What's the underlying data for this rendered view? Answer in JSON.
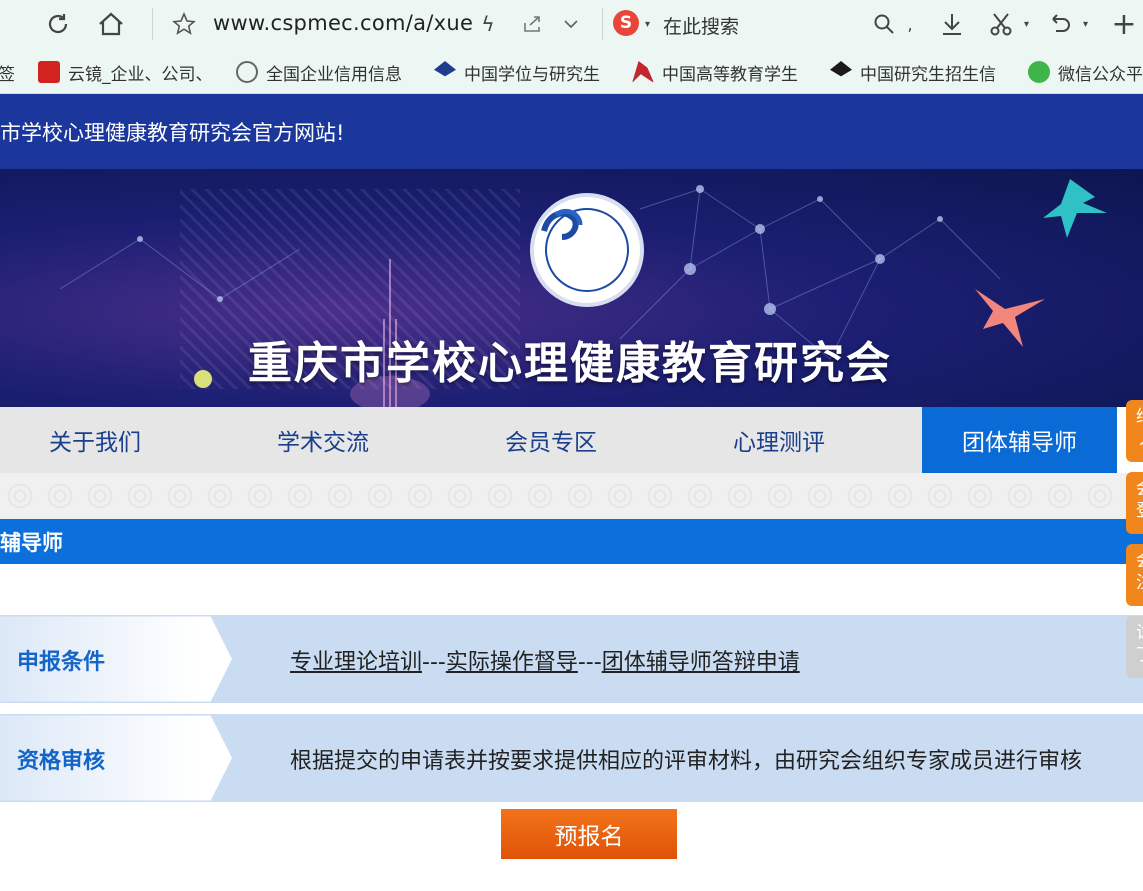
{
  "browser": {
    "url": "www.cspmec.com/a/xue",
    "search_placeholder": "在此搜索",
    "search_engine_icon": "S",
    "bookmark_partial": "签",
    "bookmarks": [
      {
        "label": "云镜_企业、公司、",
        "icon": "tianyancha-icon",
        "color": "#d3231e"
      },
      {
        "label": "全国企业信用信息",
        "icon": "globe-icon",
        "color": "#666666"
      },
      {
        "label": "中国学位与研究生",
        "icon": "graduation-cap-icon",
        "color": "#1f3d8a"
      },
      {
        "label": "中国高等教育学生",
        "icon": "bird-logo-icon",
        "color": "#c0282d"
      },
      {
        "label": "中国研究生招生信",
        "icon": "graduation-cap-icon",
        "color": "#1a1a1a"
      },
      {
        "label": "微信公众平",
        "icon": "wechat-icon",
        "color": "#3fb449"
      }
    ]
  },
  "site": {
    "welcome": "市学校心理健康教育研究会官方网站!",
    "banner_title": "重庆市学校心理健康教育研究会",
    "nav": [
      {
        "label": "关于我们",
        "active": false
      },
      {
        "label": "学术交流",
        "active": false
      },
      {
        "label": "会员专区",
        "active": false
      },
      {
        "label": "心理测评",
        "active": false
      },
      {
        "label": "团体辅导师",
        "active": true
      }
    ],
    "section_title": "辅导师",
    "rows": [
      {
        "label": "申报条件",
        "links": [
          "专业理论培训",
          "实际操作督导",
          "团体辅导师答辩申请"
        ],
        "sep": "---"
      },
      {
        "label": "资格审核",
        "text": "根据提交的申请表并按要求提供相应的评审材料，由研究会组织专家成员进行审核"
      }
    ],
    "preregister_button": "预报名",
    "float_tabs": [
      {
        "text": "给\n丿",
        "color": "#f0861c"
      },
      {
        "text": "会\n登",
        "color": "#f0861c"
      },
      {
        "text": "会\n注",
        "color": "#f0861c"
      },
      {
        "text": "试\n丁",
        "color": "#cfcfcf"
      }
    ]
  }
}
